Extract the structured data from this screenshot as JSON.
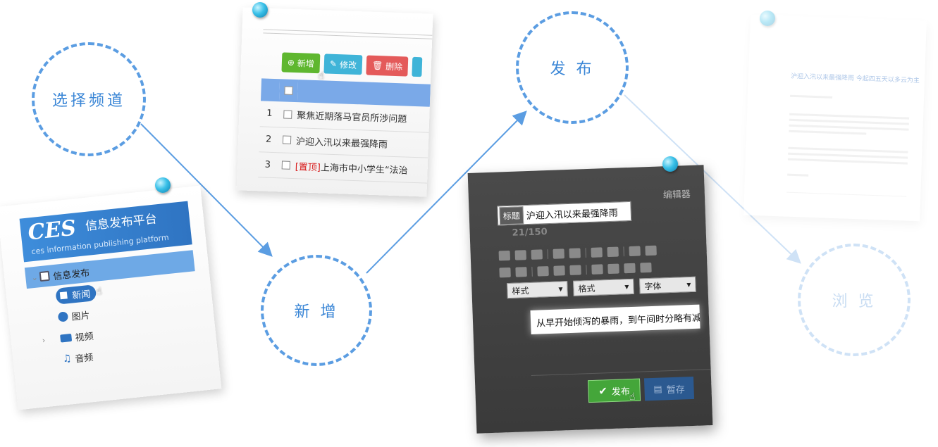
{
  "steps": [
    {
      "label": "选择频道"
    },
    {
      "label": "新 增"
    },
    {
      "label": "发 布"
    },
    {
      "label": "浏 览"
    }
  ],
  "colors": {
    "accent": "#3a86d6",
    "dash": "#5b9de2",
    "faded": "#cfe2f6"
  },
  "ces_card": {
    "logo": "CES",
    "brand": "信息发布平台",
    "tagline": "ces information publishing platform",
    "root": "信息发布",
    "channels": [
      {
        "label": "新闻",
        "icon": "news-icon"
      },
      {
        "label": "图片",
        "icon": "camera-icon"
      },
      {
        "label": "视频",
        "icon": "video-icon"
      },
      {
        "label": "音频",
        "icon": "music-icon"
      }
    ]
  },
  "list_card": {
    "buttons": {
      "add": "新增",
      "edit": "修改",
      "delete": "删除"
    },
    "rows": [
      {
        "num": "1",
        "title": "聚焦近期落马官员所涉问题"
      },
      {
        "num": "2",
        "title": "沪迎入汛以来最强降雨"
      },
      {
        "num": "3",
        "tag": "[置顶]",
        "title": "上海市中小学生“法治"
      }
    ]
  },
  "editor_card": {
    "editor_label": "编辑器",
    "title_label": "标题",
    "title_value": "沪迎入汛以来最强降雨",
    "counter": "21/150",
    "selects": {
      "style": "样式",
      "format": "格式",
      "font": "字体"
    },
    "content": "从早开始倾泻的暴雨，到午间时分略有减弱",
    "publish_label": "发布",
    "draft_label": "暂存"
  },
  "preview_card": {
    "title": "沪迎入汛以来最强降雨 今起四五天以多云为主"
  }
}
